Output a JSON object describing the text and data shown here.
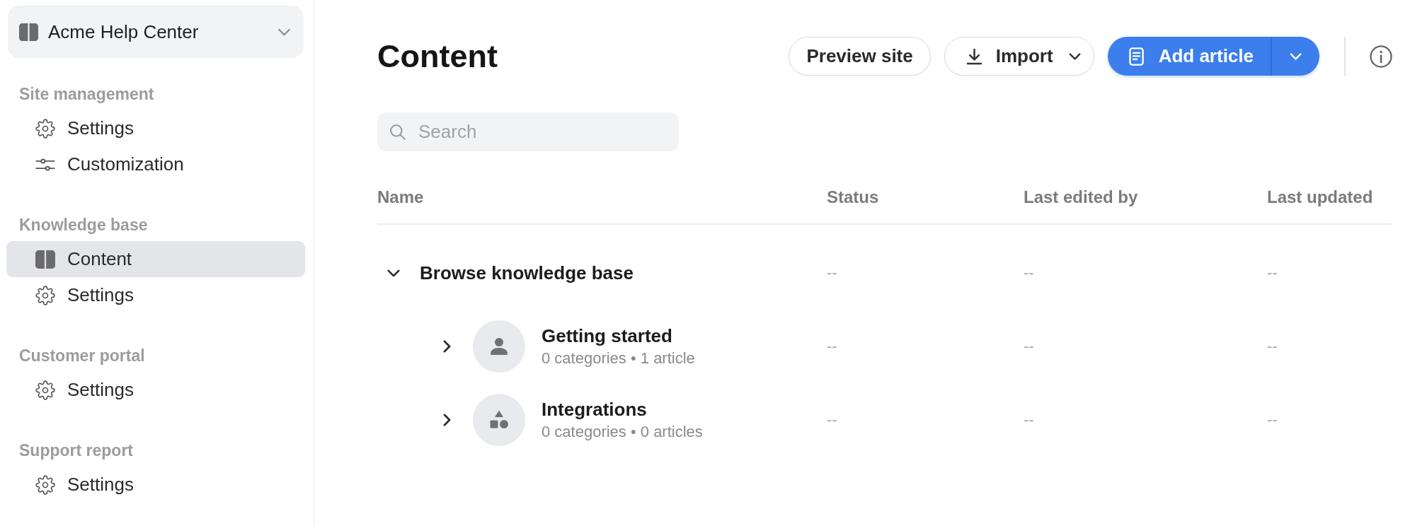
{
  "site_switcher": {
    "label": "Acme Help Center"
  },
  "sidebar": {
    "sections": [
      {
        "title": "Site management",
        "items": [
          {
            "label": "Settings",
            "kind": "gear",
            "selected": false
          },
          {
            "label": "Customization",
            "kind": "sliders",
            "selected": false
          }
        ]
      },
      {
        "title": "Knowledge base",
        "items": [
          {
            "label": "Content",
            "kind": "book",
            "selected": true
          },
          {
            "label": "Settings",
            "kind": "gear",
            "selected": false
          }
        ]
      },
      {
        "title": "Customer portal",
        "items": [
          {
            "label": "Settings",
            "kind": "gear",
            "selected": false
          }
        ]
      },
      {
        "title": "Support report",
        "items": [
          {
            "label": "Settings",
            "kind": "gear",
            "selected": false
          }
        ]
      }
    ]
  },
  "header": {
    "title": "Content",
    "preview_button": {
      "label": "Preview site"
    },
    "import_button": {
      "label": "Import"
    },
    "add_button": {
      "label": "Add article"
    }
  },
  "search": {
    "placeholder": "Search"
  },
  "table": {
    "columns": [
      "Name",
      "Status",
      "Last edited by",
      "Last updated"
    ],
    "rows": [
      {
        "name": "Browse knowledge base",
        "expanded": true,
        "status": "--",
        "last_edited_by": "--",
        "last_updated": "--",
        "children": [
          {
            "name": "Getting started",
            "meta": "0 categories • 1 article",
            "kind": "person",
            "expanded": false,
            "status": "--",
            "last_edited_by": "--",
            "last_updated": "--"
          },
          {
            "name": "Integrations",
            "meta": "0 categories • 0 articles",
            "kind": "shapes",
            "expanded": false,
            "status": "--",
            "last_edited_by": "--",
            "last_updated": "--"
          }
        ]
      }
    ]
  }
}
